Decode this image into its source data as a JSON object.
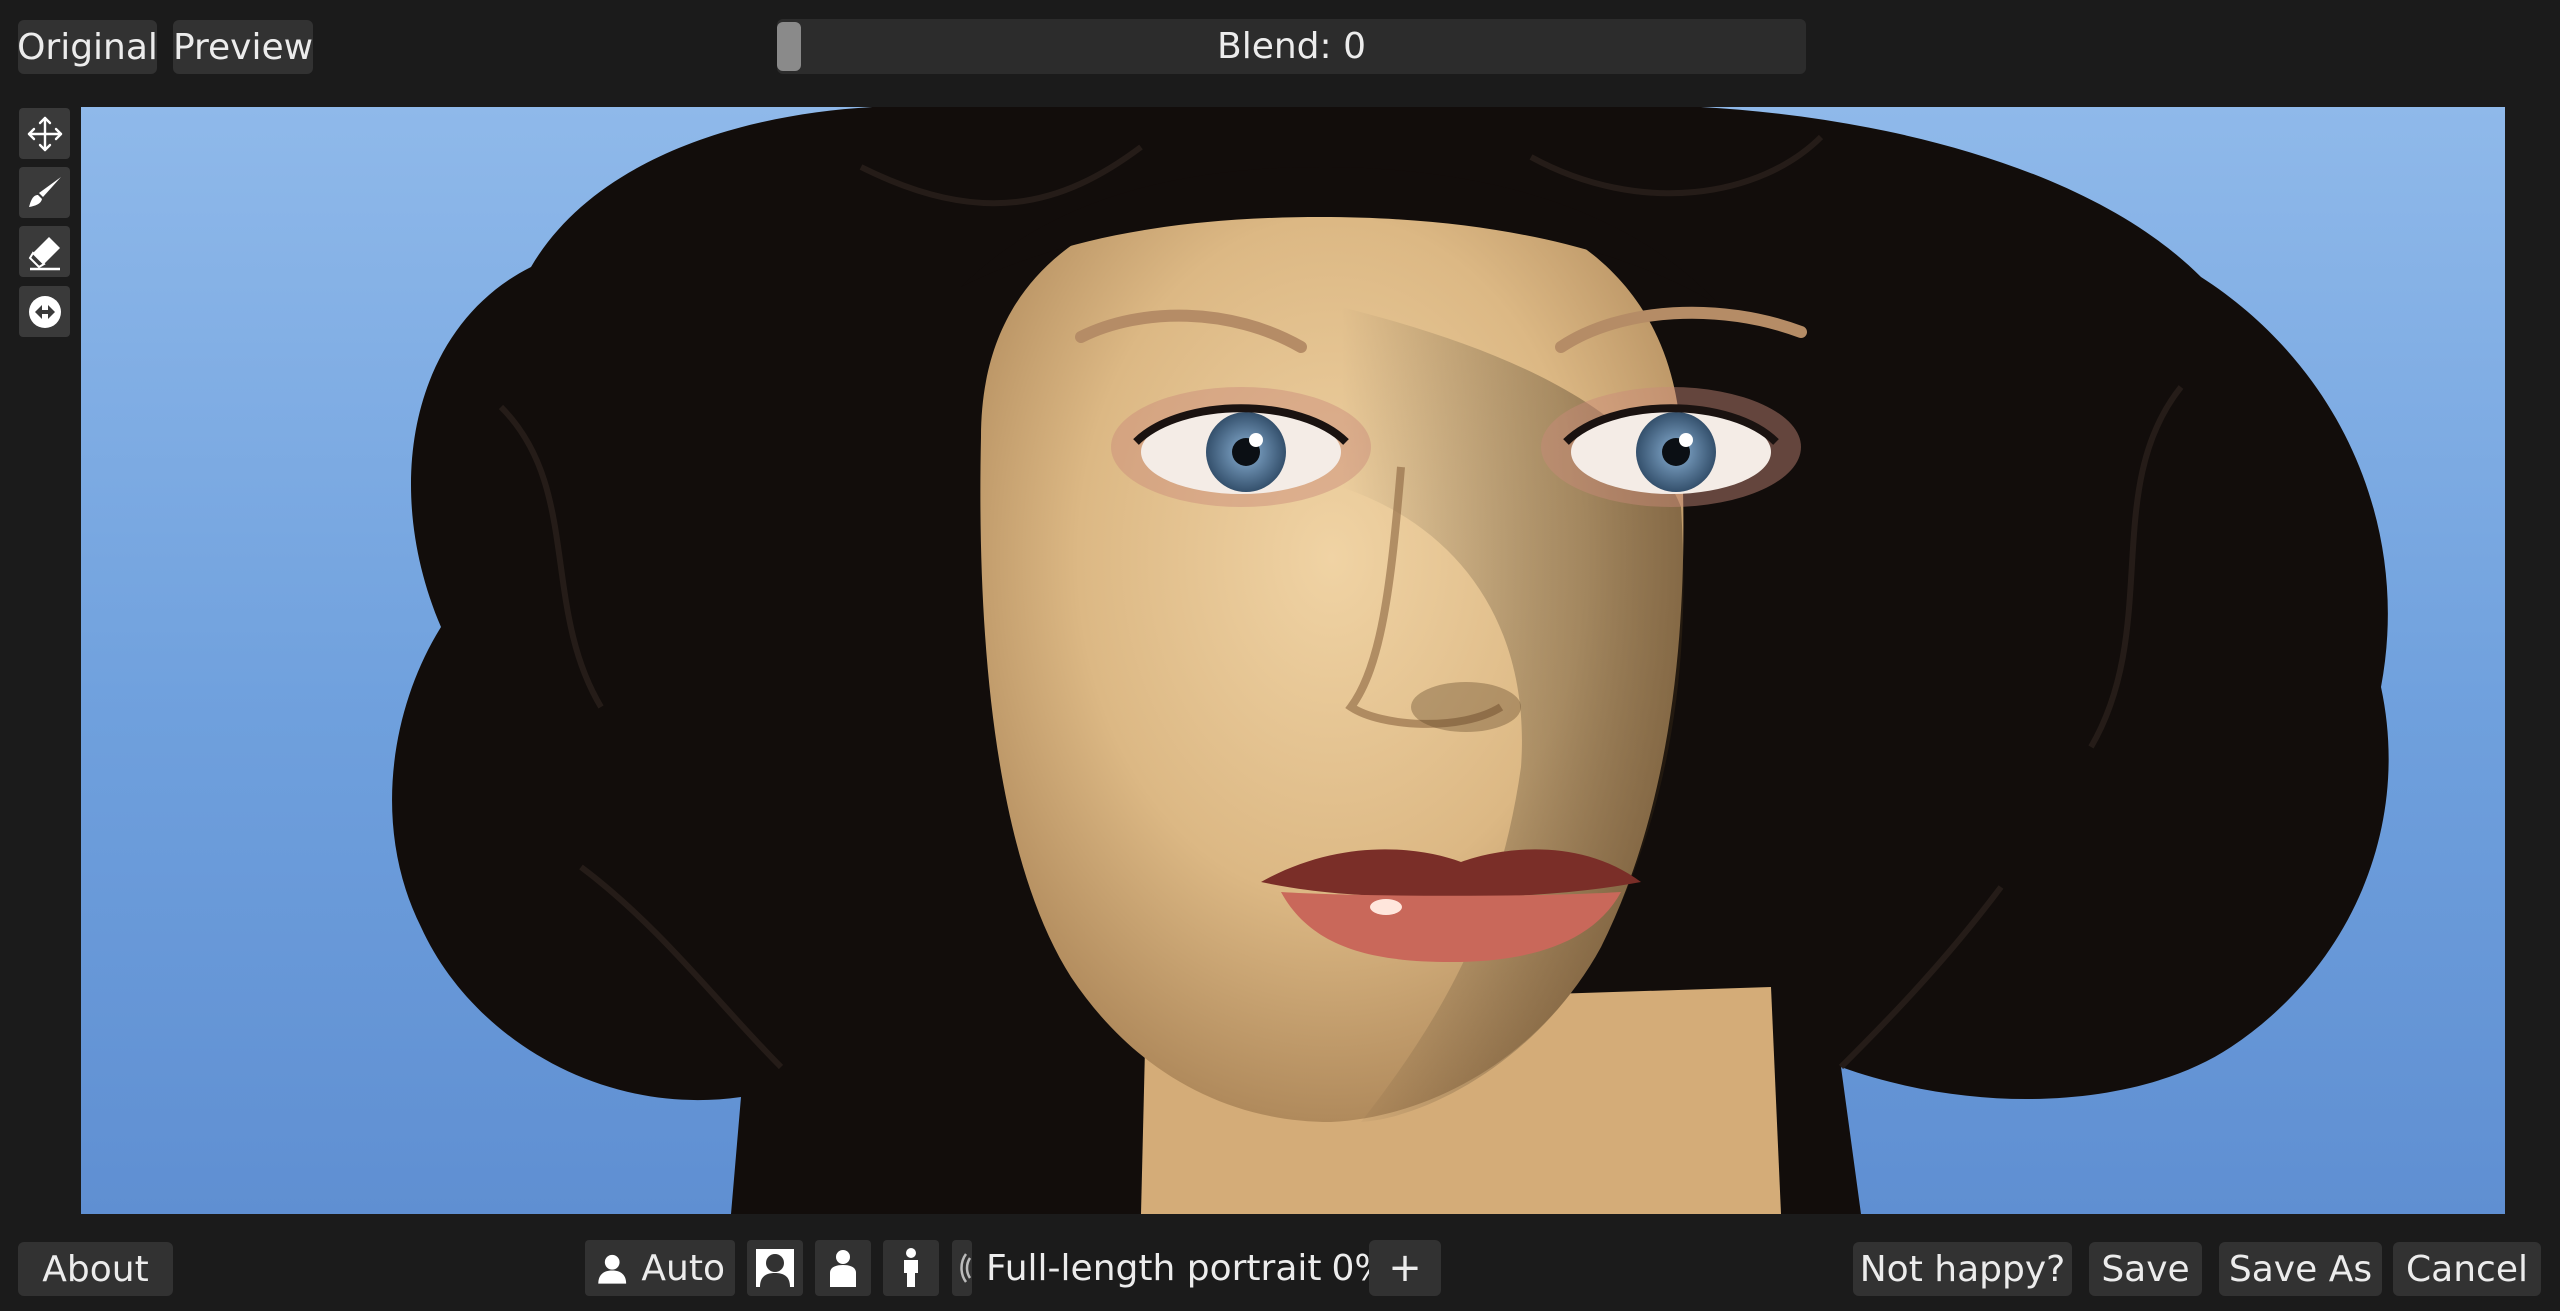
{
  "top_bar": {
    "original_label": "Original",
    "preview_label": "Preview",
    "blend_label": "Blend: 0",
    "blend_value": 0
  },
  "toolbar": {
    "tools": [
      "move-icon",
      "brush-icon",
      "eraser-icon",
      "reset-icon"
    ]
  },
  "bottom_bar": {
    "about_label": "About",
    "auto_label": "Auto",
    "mode_label": "Full-length portrait",
    "percent_text": "0%",
    "plus_label": "+",
    "not_happy_label": "Not happy?",
    "save_label": "Save",
    "save_as_label": "Save As",
    "cancel_label": "Cancel"
  }
}
